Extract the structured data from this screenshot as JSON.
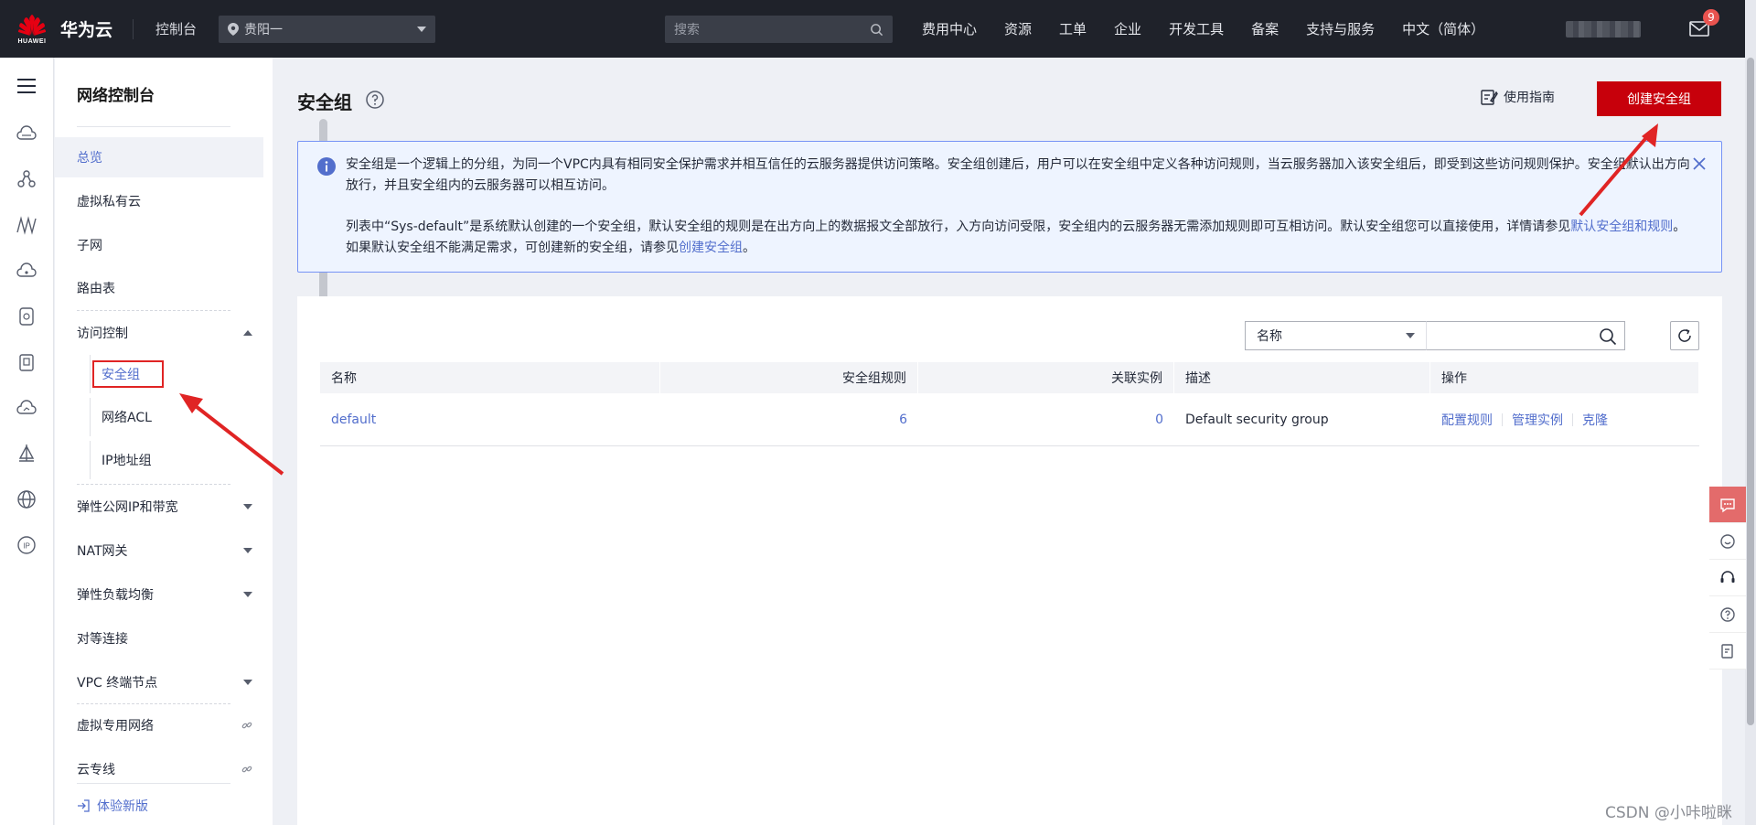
{
  "topbar": {
    "logo_text": "HUAWEI",
    "brand": "华为云",
    "console": "控制台",
    "region": "贵阳一",
    "search_placeholder": "搜索",
    "nav": [
      "费用中心",
      "资源",
      "工单",
      "企业",
      "开发工具",
      "备案",
      "支持与服务",
      "中文（简体）"
    ],
    "mail_badge": "9"
  },
  "rail_icons": [
    "menu-icon",
    "cloud-icon",
    "network-icon",
    "vpc-peer-icon",
    "router-icon",
    "dns-icon",
    "nat-icon",
    "cloud-sync-icon",
    "sail-icon",
    "globe-icon",
    "ip-icon"
  ],
  "sidebar": {
    "title": "网络控制台",
    "items": [
      {
        "label": "总览"
      },
      {
        "label": "虚拟私有云"
      },
      {
        "label": "子网"
      },
      {
        "label": "路由表"
      },
      {
        "label": "访问控制"
      },
      {
        "label": "弹性公网IP和带宽"
      },
      {
        "label": "NAT网关"
      },
      {
        "label": "弹性负载均衡"
      },
      {
        "label": "对等连接"
      },
      {
        "label": "VPC 终端节点"
      },
      {
        "label": "虚拟专用网络"
      },
      {
        "label": "云专线"
      }
    ],
    "sub_items": [
      {
        "label": "安全组"
      },
      {
        "label": "网络ACL"
      },
      {
        "label": "IP地址组"
      }
    ],
    "footer": "体验新版"
  },
  "main": {
    "title": "安全组",
    "guide": "使用指南",
    "create_button": "创建安全组",
    "info": {
      "p1": "安全组是一个逻辑上的分组，为同一个VPC内具有相同安全保护需求并相互信任的云服务器提供访问策略。安全组创建后，用户可以在安全组中定义各种访问规则，当云服务器加入该安全组后，即受到这些访问规则保护。安全组默认出方向放行，并且安全组内的云服务器可以相互访问。",
      "p2_a": "列表中“Sys-default”是系统默认创建的一个安全组，默认安全组的规则是在出方向上的数据报文全部放行，入方向访问受限，安全组内的云服务器无需添加规则即可互相访问。默认安全组您可以直接使用，详情请参见",
      "p2_link1": "默认安全组和规则",
      "p2_b": "。如果默认安全组不能满足需求，可创建新的安全组，请参见",
      "p2_link2": "创建安全组",
      "p2_c": "。"
    },
    "filter": {
      "field": "名称",
      "value": ""
    },
    "table": {
      "columns": [
        "名称",
        "安全组规则",
        "关联实例",
        "描述",
        "操作"
      ],
      "rows": [
        {
          "name": "default",
          "rules": "6",
          "instances": "0",
          "description": "Default security group",
          "actions": [
            "配置规则",
            "管理实例",
            "克隆"
          ]
        }
      ]
    }
  },
  "colors": {
    "topbar": "#1f222a",
    "primary_red": "#c7000b",
    "link": "#526ecc",
    "annotation": "#e02424"
  },
  "watermark": "CSDN @小咔啦眯"
}
